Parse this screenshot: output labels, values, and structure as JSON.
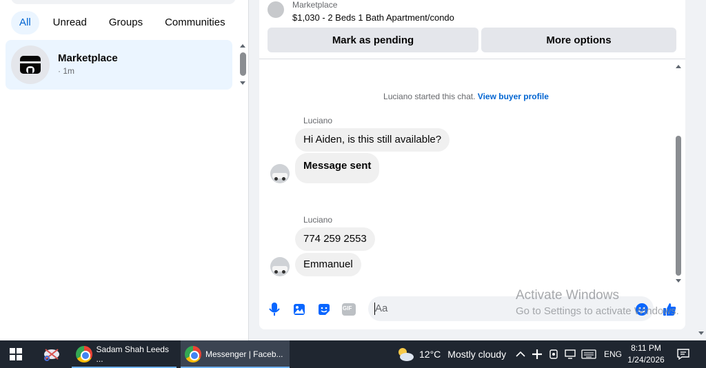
{
  "left": {
    "filters": [
      "All",
      "Unread",
      "Groups",
      "Communities"
    ],
    "active_filter": "All",
    "conversation": {
      "name": "Marketplace",
      "time": "· 1m",
      "icon": "storefront-icon"
    }
  },
  "header": {
    "title": "Marketplace",
    "listing": "$1,030 - 2 Beds 1 Bath Apartment/condo",
    "mark_pending": "Mark as pending",
    "more_options": "More options"
  },
  "chat": {
    "system_text": "Luciano started this chat.",
    "system_link": "View buyer profile",
    "groups": [
      {
        "sender": "Luciano",
        "messages": [
          "Hi Aiden, is this still available?",
          "Message sent"
        ]
      },
      {
        "sender": "Luciano",
        "messages": [
          "774 259 2553",
          "Emmanuel"
        ]
      }
    ]
  },
  "composer": {
    "placeholder": "Aa",
    "icons": [
      "microphone-icon",
      "image-icon",
      "sticker-icon",
      "gif-icon",
      "emoji-icon",
      "thumbs-up-icon"
    ],
    "gif_label": "GIF"
  },
  "watermark": {
    "line1": "Activate Windows",
    "line2": "Go to Settings to activate Windows."
  },
  "taskbar": {
    "apps": [
      {
        "label": "Sadam Shah Leeds ...",
        "active": false
      },
      {
        "label": "Messenger | Faceb...",
        "active": true
      }
    ],
    "weather": {
      "temp": "12°C",
      "desc": "Mostly cloudy"
    },
    "language": "ENG",
    "time": "8:11 PM",
    "date": "1/24/2026"
  },
  "colors": {
    "accent": "#0064d1",
    "icon_blue": "#0866ff",
    "taskbar": "#1f2630"
  }
}
